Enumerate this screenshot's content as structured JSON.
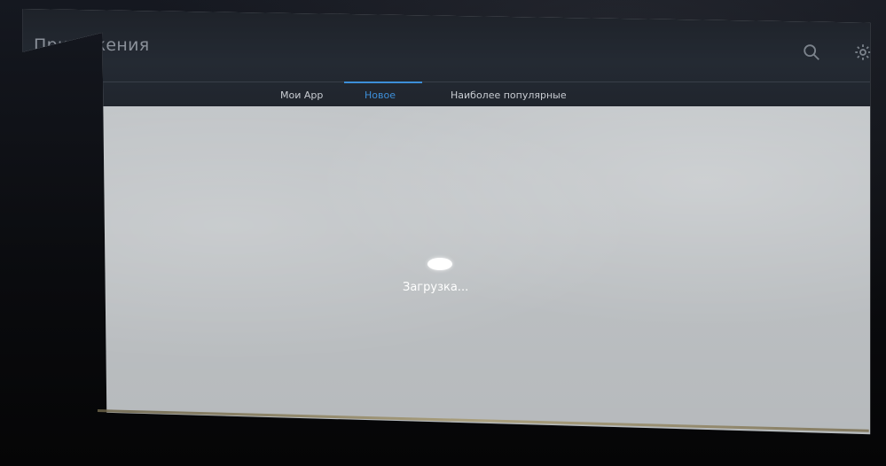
{
  "header": {
    "title": "Приложения",
    "icons": {
      "search": "search-icon",
      "settings": "gear-icon"
    }
  },
  "tabs": [
    {
      "label": "Мои App",
      "active": false
    },
    {
      "label": "Новое",
      "active": true
    },
    {
      "label": "Наиболее популярные",
      "active": false
    }
  ],
  "content": {
    "loading_text": "Загрузка..."
  },
  "colors": {
    "accent": "#3d8fd9",
    "header_bg": "#222730",
    "screen_bg": "#cfd3d6"
  }
}
